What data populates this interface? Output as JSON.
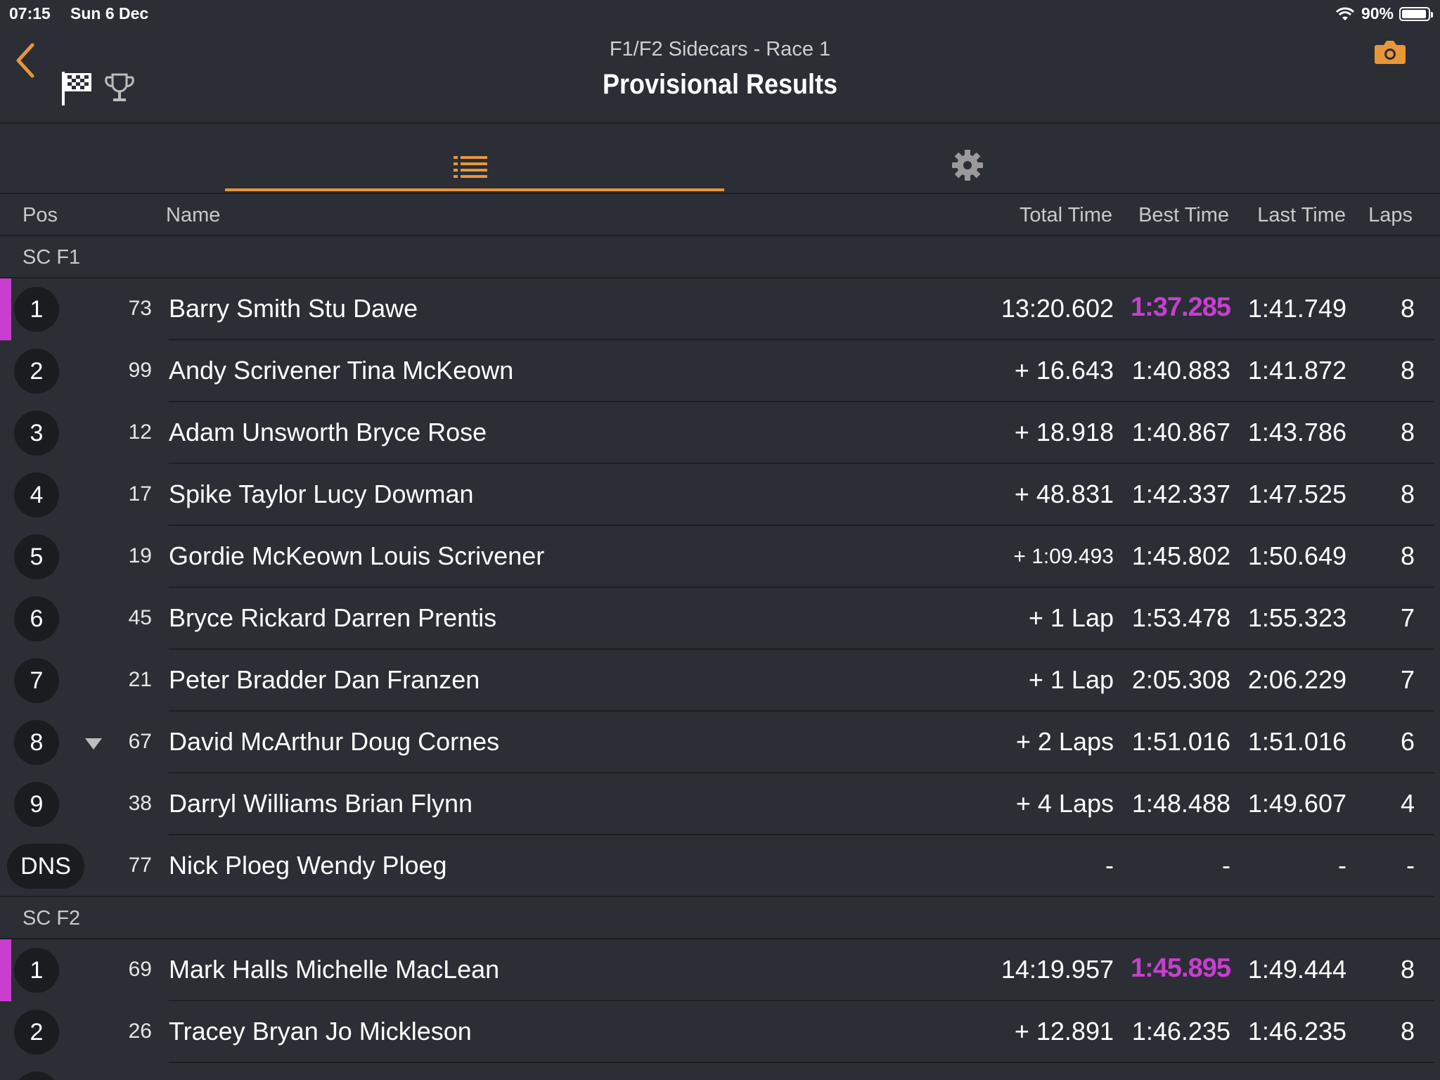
{
  "status": {
    "time": "07:15",
    "date": "Sun 6 Dec",
    "battery": "90%",
    "battery_level": 0.9
  },
  "header": {
    "subtitle": "F1/F2 Sidecars - Race 1",
    "title": "Provisional Results"
  },
  "icons": {
    "back": "chevron-left-icon",
    "flag": "checkered-flag-icon",
    "trophy": "trophy-icon",
    "camera": "camera-icon",
    "list": "list-icon",
    "settings": "gear-icon",
    "wifi": "wifi-icon",
    "battery": "battery-icon"
  },
  "colors": {
    "accent": "#e8963a",
    "fastest": "#c83fcf",
    "background": "#2b2e35"
  },
  "columns": {
    "pos": "Pos",
    "name": "Name",
    "total": "Total Time",
    "best": "Best Time",
    "last": "Last Time",
    "laps": "Laps"
  },
  "groups": [
    {
      "label": "SC F1",
      "rows": [
        {
          "pos": "1",
          "num": "73",
          "name": "Barry Smith Stu Dawe",
          "total": "13:20.602",
          "best": "1:37.285",
          "last": "1:41.749",
          "laps": "8",
          "fastest": true
        },
        {
          "pos": "2",
          "num": "99",
          "name": "Andy Scrivener Tina McKeown",
          "total": "+ 16.643",
          "best": "1:40.883",
          "last": "1:41.872",
          "laps": "8"
        },
        {
          "pos": "3",
          "num": "12",
          "name": "Adam Unsworth Bryce Rose",
          "total": "+ 18.918",
          "best": "1:40.867",
          "last": "1:43.786",
          "laps": "8"
        },
        {
          "pos": "4",
          "num": "17",
          "name": "Spike Taylor Lucy Dowman",
          "total": "+ 48.831",
          "best": "1:42.337",
          "last": "1:47.525",
          "laps": "8"
        },
        {
          "pos": "5",
          "num": "19",
          "name": "Gordie McKeown Louis Scrivener",
          "total": "+ 1:09.493",
          "best": "1:45.802",
          "last": "1:50.649",
          "laps": "8",
          "small_total": true
        },
        {
          "pos": "6",
          "num": "45",
          "name": "Bryce Rickard Darren Prentis",
          "total": "+ 1 Lap",
          "best": "1:53.478",
          "last": "1:55.323",
          "laps": "7"
        },
        {
          "pos": "7",
          "num": "21",
          "name": "Peter Bradder Dan Franzen",
          "total": "+ 1 Lap",
          "best": "2:05.308",
          "last": "2:06.229",
          "laps": "7"
        },
        {
          "pos": "8",
          "num": "67",
          "name": "David McArthur Doug Cornes",
          "total": "+ 2 Laps",
          "best": "1:51.016",
          "last": "1:51.016",
          "laps": "6",
          "dropped": true
        },
        {
          "pos": "9",
          "num": "38",
          "name": "Darryl Williams Brian Flynn",
          "total": "+ 4 Laps",
          "best": "1:48.488",
          "last": "1:49.607",
          "laps": "4"
        },
        {
          "pos": "DNS",
          "num": "77",
          "name": "Nick Ploeg Wendy Ploeg",
          "total": "-",
          "best": "-",
          "last": "-",
          "laps": "-"
        }
      ]
    },
    {
      "label": "SC F2",
      "rows": [
        {
          "pos": "1",
          "num": "69",
          "name": "Mark Halls Michelle MacLean",
          "total": "14:19.957",
          "best": "1:45.895",
          "last": "1:49.444",
          "laps": "8",
          "fastest": true
        },
        {
          "pos": "2",
          "num": "26",
          "name": "Tracey Bryan Jo Mickleson",
          "total": "+ 12.891",
          "best": "1:46.235",
          "last": "1:46.235",
          "laps": "8"
        }
      ]
    }
  ]
}
